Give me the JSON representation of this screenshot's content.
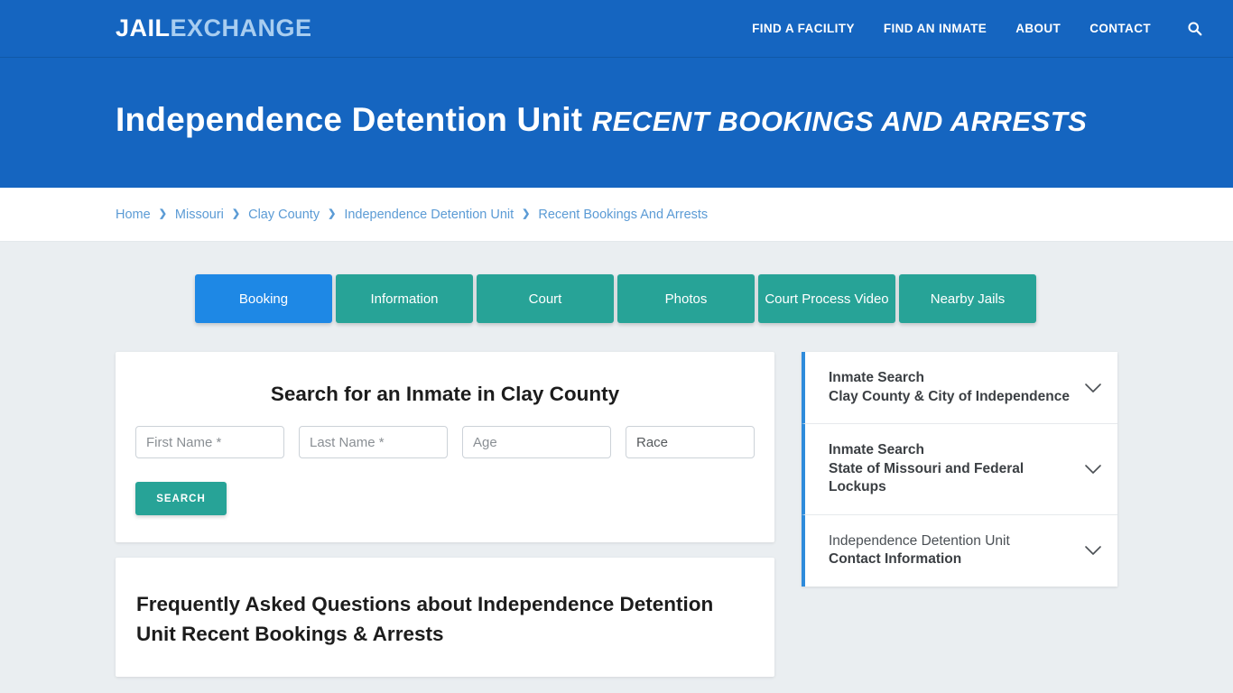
{
  "header": {
    "logo_part1": "JAIL",
    "logo_part2": "EXCHANGE",
    "nav": [
      {
        "label": "FIND A FACILITY"
      },
      {
        "label": "FIND AN INMATE"
      },
      {
        "label": "ABOUT"
      },
      {
        "label": "CONTACT"
      }
    ],
    "search_icon": "search-icon",
    "brand_color": "#1565c0"
  },
  "hero": {
    "title_main": "Independence Detention Unit ",
    "title_sub": "Recent Bookings and Arrests"
  },
  "breadcrumb": {
    "separator": "❯",
    "items": [
      {
        "label": "Home"
      },
      {
        "label": "Missouri"
      },
      {
        "label": "Clay County"
      },
      {
        "label": "Independence Detention Unit"
      },
      {
        "label": "Recent Bookings And Arrests"
      }
    ]
  },
  "tabs": [
    {
      "label": "Booking",
      "active": true
    },
    {
      "label": "Information",
      "active": false
    },
    {
      "label": "Court",
      "active": false
    },
    {
      "label": "Photos",
      "active": false
    },
    {
      "label": "Court Process Video",
      "active": false
    },
    {
      "label": "Nearby Jails",
      "active": false
    }
  ],
  "tab_colors": {
    "active": "#1e88e5",
    "inactive": "#27a397"
  },
  "search_form": {
    "title": "Search for an Inmate in Clay County",
    "first_name_placeholder": "First Name *",
    "last_name_placeholder": "Last Name *",
    "age_placeholder": "Age",
    "race_selected": "Race",
    "race_options": [
      "Race"
    ],
    "submit_label": "SEARCH",
    "submit_color": "#27a397"
  },
  "faq": {
    "title": "Frequently Asked Questions about Independence Detention Unit Recent Bookings & Arrests"
  },
  "sidebar": {
    "accent_color": "#2e8bdb",
    "items": [
      {
        "line1": "Inmate Search",
        "line2": "Clay County & City of Independence",
        "line1_bold": true,
        "icon": "chevron-down-icon"
      },
      {
        "line1": "Inmate Search",
        "line2": "State of Missouri and Federal Lockups",
        "line1_bold": true,
        "icon": "chevron-down-icon"
      },
      {
        "line1": "Independence Detention Unit",
        "line2": "Contact Information",
        "line1_bold": false,
        "icon": "chevron-down-icon"
      }
    ]
  }
}
